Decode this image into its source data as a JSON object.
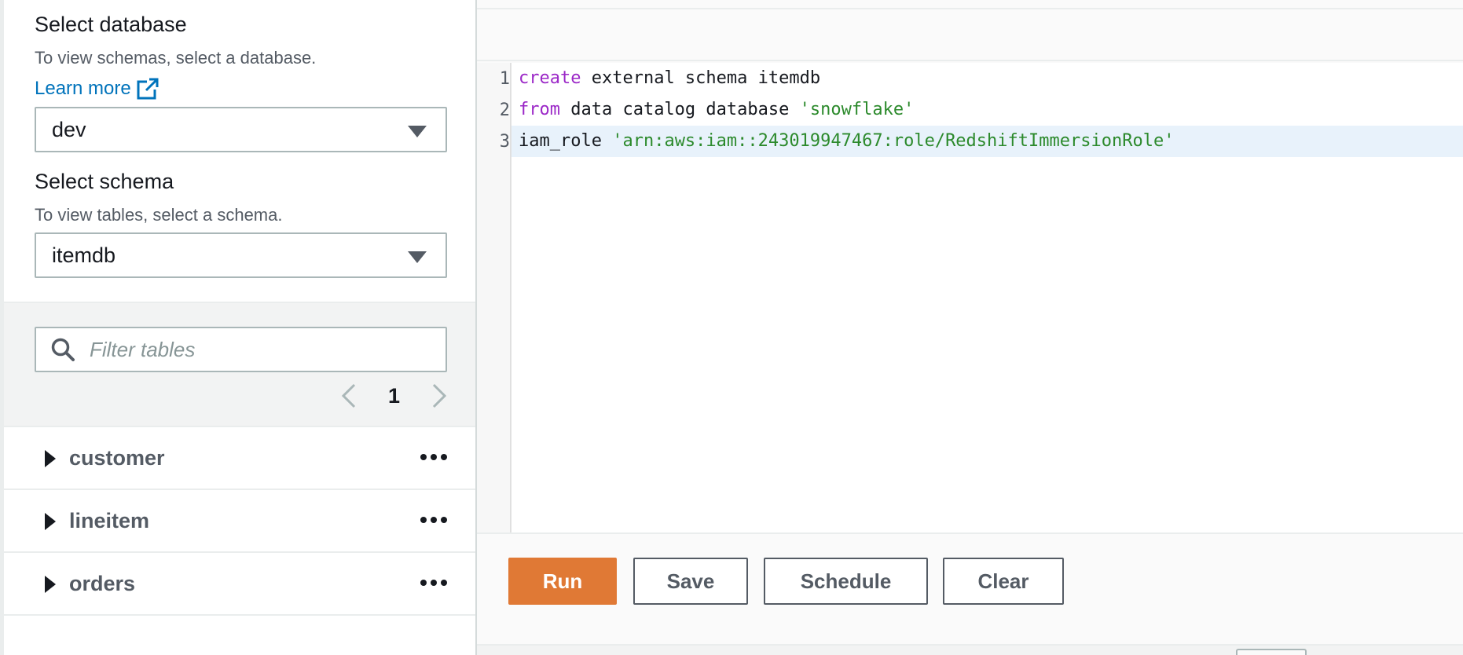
{
  "database": {
    "heading": "Select database",
    "hint": "To view schemas, select a database.",
    "learn_more": "Learn more",
    "selected": "dev"
  },
  "schema": {
    "heading": "Select schema",
    "hint": "To view tables, select a schema.",
    "selected": "itemdb"
  },
  "filter": {
    "placeholder": "Filter tables",
    "page": "1"
  },
  "tables": [
    "customer",
    "lineitem",
    "orders"
  ],
  "editor": {
    "line_numbers": [
      "1",
      "2",
      "3"
    ],
    "lines": [
      [
        {
          "t": "create",
          "c": "kw"
        },
        {
          "t": " external schema itemdb",
          "c": ""
        }
      ],
      [
        {
          "t": "from",
          "c": "kw"
        },
        {
          "t": " data catalog database ",
          "c": ""
        },
        {
          "t": "'snowflake'",
          "c": "str"
        }
      ],
      [
        {
          "t": "iam_role ",
          "c": ""
        },
        {
          "t": "'arn:aws:iam::243019947467:role/RedshiftImmersionRole'",
          "c": "str"
        }
      ]
    ],
    "active_line": 3
  },
  "buttons": {
    "run": "Run",
    "save": "Save",
    "schedule": "Schedule",
    "clear": "Clear"
  },
  "colors": {
    "primary": "#e07935",
    "link": "#0073bb",
    "keyword": "#9b27c7",
    "string": "#2c8a2c"
  }
}
